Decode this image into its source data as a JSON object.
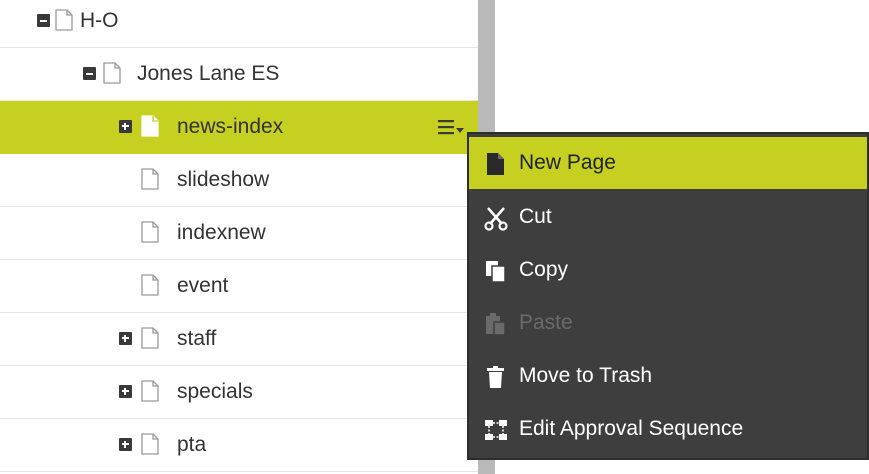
{
  "tree": {
    "rows": [
      {
        "label": "H-O",
        "toggle": "minus"
      },
      {
        "label": "Jones Lane ES",
        "toggle": "minus"
      },
      {
        "label": "news-index",
        "toggle": "plus",
        "selected": true
      },
      {
        "label": "slideshow",
        "toggle": "none"
      },
      {
        "label": "indexnew",
        "toggle": "none"
      },
      {
        "label": "event",
        "toggle": "none"
      },
      {
        "label": "staff",
        "toggle": "plus"
      },
      {
        "label": "specials",
        "toggle": "plus"
      },
      {
        "label": "pta",
        "toggle": "plus"
      }
    ]
  },
  "context_menu": {
    "items": [
      {
        "label": "New Page",
        "icon": "new-page-icon",
        "state": "active"
      },
      {
        "label": "Cut",
        "icon": "scissors-icon",
        "state": "normal"
      },
      {
        "label": "Copy",
        "icon": "copy-icon",
        "state": "normal"
      },
      {
        "label": "Paste",
        "icon": "paste-icon",
        "state": "disabled"
      },
      {
        "label": "Move to Trash",
        "icon": "trash-icon",
        "state": "normal"
      },
      {
        "label": "Edit Approval Sequence",
        "icon": "approval-sequence-icon",
        "state": "normal"
      }
    ]
  },
  "colors": {
    "accent": "#c6d021",
    "menu_bg": "#3e3e3e",
    "disabled_text": "#6a6a6a"
  }
}
